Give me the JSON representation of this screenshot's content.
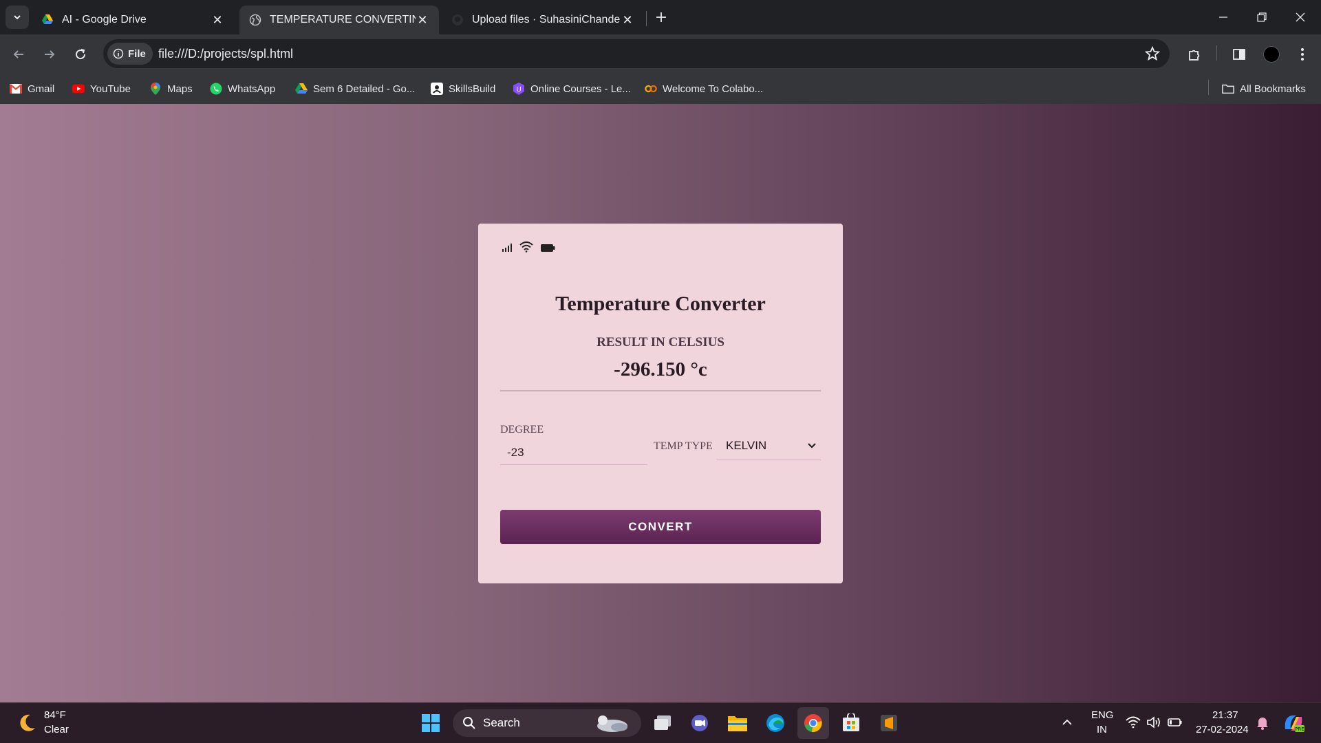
{
  "browser": {
    "tabs": [
      {
        "title": "AI - Google Drive",
        "active": false
      },
      {
        "title": "TEMPERATURE CONVERTING W",
        "active": true
      },
      {
        "title": "Upload files · SuhasiniChandeka",
        "active": false
      }
    ],
    "url_chip": "File",
    "url": "file:///D:/projects/spl.html",
    "bookmarks": [
      {
        "label": "Gmail",
        "icon": "gmail-icon"
      },
      {
        "label": "YouTube",
        "icon": "youtube-icon"
      },
      {
        "label": "Maps",
        "icon": "maps-icon"
      },
      {
        "label": "WhatsApp",
        "icon": "whatsapp-icon"
      },
      {
        "label": "Sem 6 Detailed - Go...",
        "icon": "drive-icon"
      },
      {
        "label": "SkillsBuild",
        "icon": "skillsbuild-icon"
      },
      {
        "label": "Online Courses - Le...",
        "icon": "online-courses-icon"
      },
      {
        "label": "Welcome To Colabo...",
        "icon": "colab-icon"
      }
    ],
    "all_bookmarks": "All Bookmarks"
  },
  "app": {
    "title": "Temperature Converter",
    "result_label": "RESULT IN CELSIUS",
    "result_value": "-296.150 °c",
    "degree_label": "DEGREE",
    "degree_value": "-23",
    "temp_type_label": "TEMP TYPE",
    "temp_type_selected": "KELVIN",
    "convert_label": "CONVERT"
  },
  "taskbar": {
    "weather_temp": "84°F",
    "weather_condition": "Clear",
    "search_placeholder": "Search",
    "lang_top": "ENG",
    "lang_bottom": "IN",
    "time": "21:37",
    "date": "27-02-2024"
  },
  "colors": {
    "accent_button": "#6a2c5f",
    "card_bg": "#f1d5dc"
  }
}
